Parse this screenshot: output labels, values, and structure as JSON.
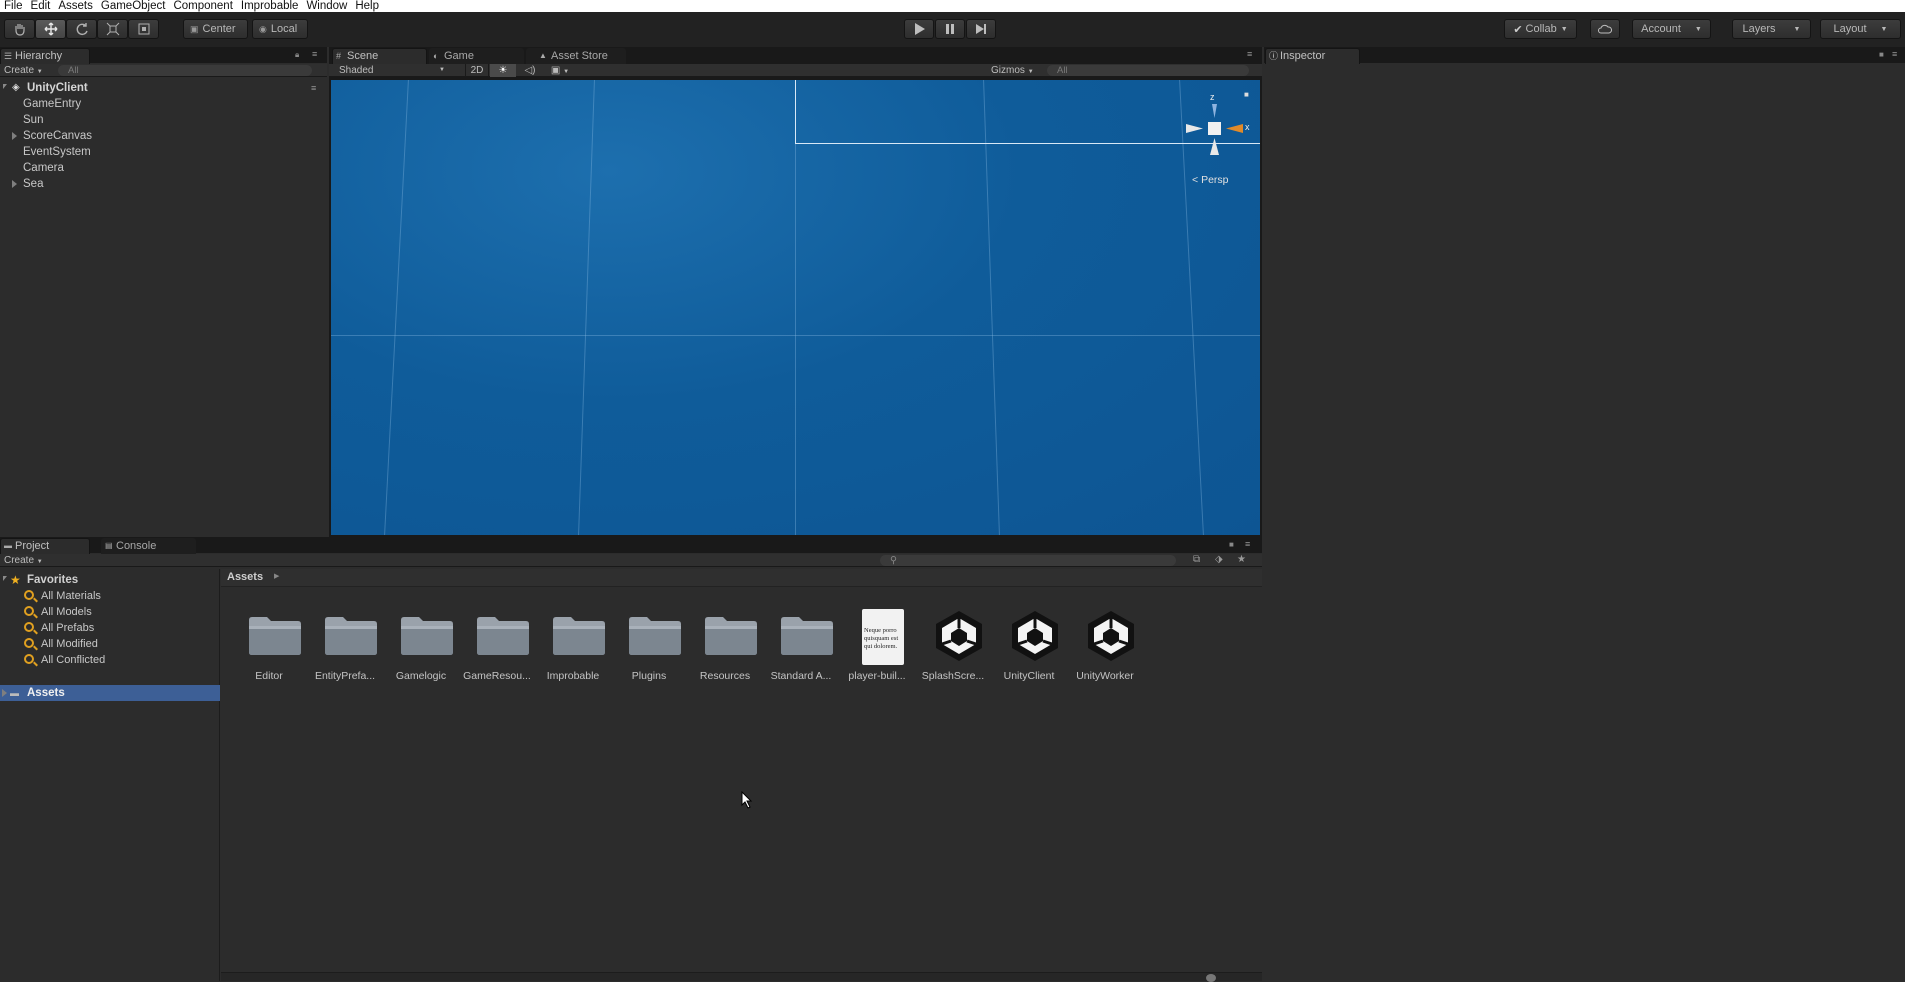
{
  "menu": [
    "File",
    "Edit",
    "Assets",
    "GameObject",
    "Component",
    "Improbable",
    "Window",
    "Help"
  ],
  "toolbar": {
    "pivot_center": "Center",
    "pivot_local": "Local",
    "collab": "Collab",
    "account": "Account",
    "layers": "Layers",
    "layout": "Layout"
  },
  "hierarchy": {
    "tab": "Hierarchy",
    "create": "Create",
    "search_placeholder": "All",
    "root": "UnityClient",
    "items": [
      "GameEntry",
      "Sun",
      "ScoreCanvas",
      "EventSystem",
      "Camera",
      "Sea"
    ]
  },
  "scene": {
    "tabs": [
      "Scene",
      "Game",
      "Asset Store"
    ],
    "shading": "Shaded",
    "mode_2d": "2D",
    "gizmos": "Gizmos",
    "search_placeholder": "All",
    "axis_z": "z",
    "axis_x": "x",
    "projection": "Persp"
  },
  "inspector": {
    "tab": "Inspector"
  },
  "project": {
    "tabs": [
      "Project",
      "Console"
    ],
    "create": "Create",
    "favorites_title": "Favorites",
    "favorites": [
      "All Materials",
      "All Models",
      "All Prefabs",
      "All Modified",
      "All Conflicted"
    ],
    "assets_root": "Assets",
    "breadcrumb": "Assets",
    "assets": [
      {
        "name": "Editor",
        "kind": "folder"
      },
      {
        "name": "EntityPrefa...",
        "kind": "folder"
      },
      {
        "name": "Gamelogic",
        "kind": "folder"
      },
      {
        "name": "GameResou...",
        "kind": "folder"
      },
      {
        "name": "Improbable",
        "kind": "folder"
      },
      {
        "name": "Plugins",
        "kind": "folder"
      },
      {
        "name": "Resources",
        "kind": "folder"
      },
      {
        "name": "Standard A...",
        "kind": "folder"
      },
      {
        "name": "player-buil...",
        "kind": "text",
        "preview": "Neque porro quisquam est qui dolorem."
      },
      {
        "name": "SplashScre...",
        "kind": "unity"
      },
      {
        "name": "UnityClient",
        "kind": "unity"
      },
      {
        "name": "UnityWorker",
        "kind": "unity"
      }
    ]
  },
  "colors": {
    "selection": "#3d5f96",
    "scene_blue": "#0f5c9a",
    "favorite_star": "#f0b020"
  }
}
